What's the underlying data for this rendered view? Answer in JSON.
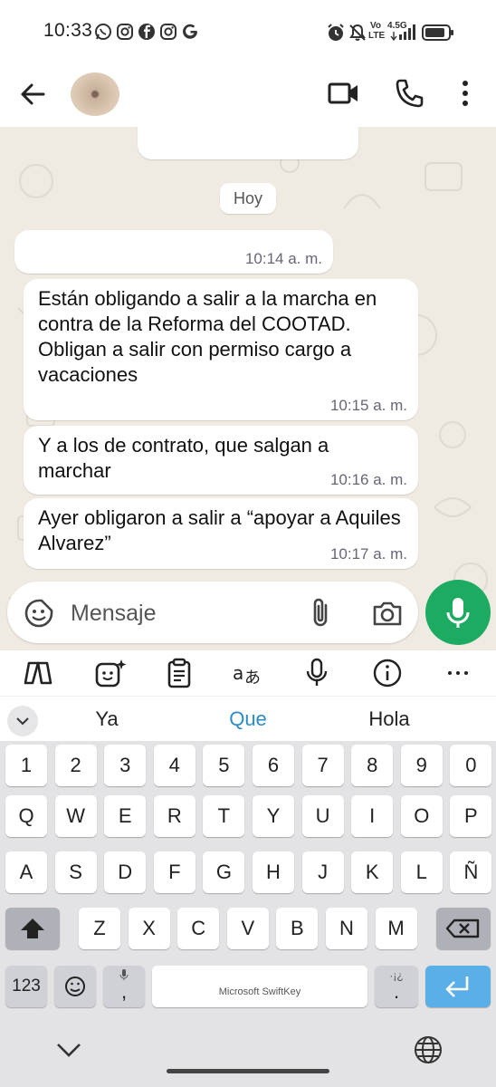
{
  "status_bar": {
    "time": "10:33",
    "app_icons": [
      "whatsapp-icon",
      "instagram-icon",
      "facebook-icon",
      "instagram-icon",
      "google-icon"
    ],
    "network_top": "Vo",
    "network_bottom": "LTE",
    "signal_label": "4.5G"
  },
  "header": {
    "icons": [
      "back-arrow-icon",
      "video-call-icon",
      "phone-icon",
      "more-vert-icon"
    ]
  },
  "chat": {
    "background_color": "#efeae2",
    "day_label": "Hoy",
    "messages": [
      {
        "text": "",
        "time": "10:14 a. m."
      },
      {
        "text": "Están obligando a salir a la marcha en contra de la Reforma del COOTAD.  Obligan a salir con permiso cargo a vacaciones",
        "time": "10:15 a. m."
      },
      {
        "text": "Y a los de contrato, que salgan a marchar",
        "time": "10:16 a. m."
      },
      {
        "text": "Ayer obligaron a salir a “apoyar a Aquiles Alvarez”",
        "time": "10:17 a. m."
      }
    ]
  },
  "composer": {
    "placeholder": "Mensaje",
    "mic_color": "#1daa61"
  },
  "keyboard": {
    "suggestions": [
      "Ya",
      "Que",
      "Hola"
    ],
    "suggestion_highlight_color": "#2e8bc9",
    "number_row": [
      "1",
      "2",
      "3",
      "4",
      "5",
      "6",
      "7",
      "8",
      "9",
      "0"
    ],
    "row1": [
      "Q",
      "W",
      "E",
      "R",
      "T",
      "Y",
      "U",
      "I",
      "O",
      "P"
    ],
    "row2": [
      "A",
      "S",
      "D",
      "F",
      "G",
      "H",
      "J",
      "K",
      "L",
      "Ñ"
    ],
    "row3": [
      "Z",
      "X",
      "C",
      "V",
      "B",
      "N",
      "M"
    ],
    "numbers_key": "123",
    "comma_key": ",",
    "period_key": ".",
    "period_sub": "·¡¿",
    "space_label": "Microsoft SwiftKey",
    "enter_color": "#5aafe6"
  }
}
